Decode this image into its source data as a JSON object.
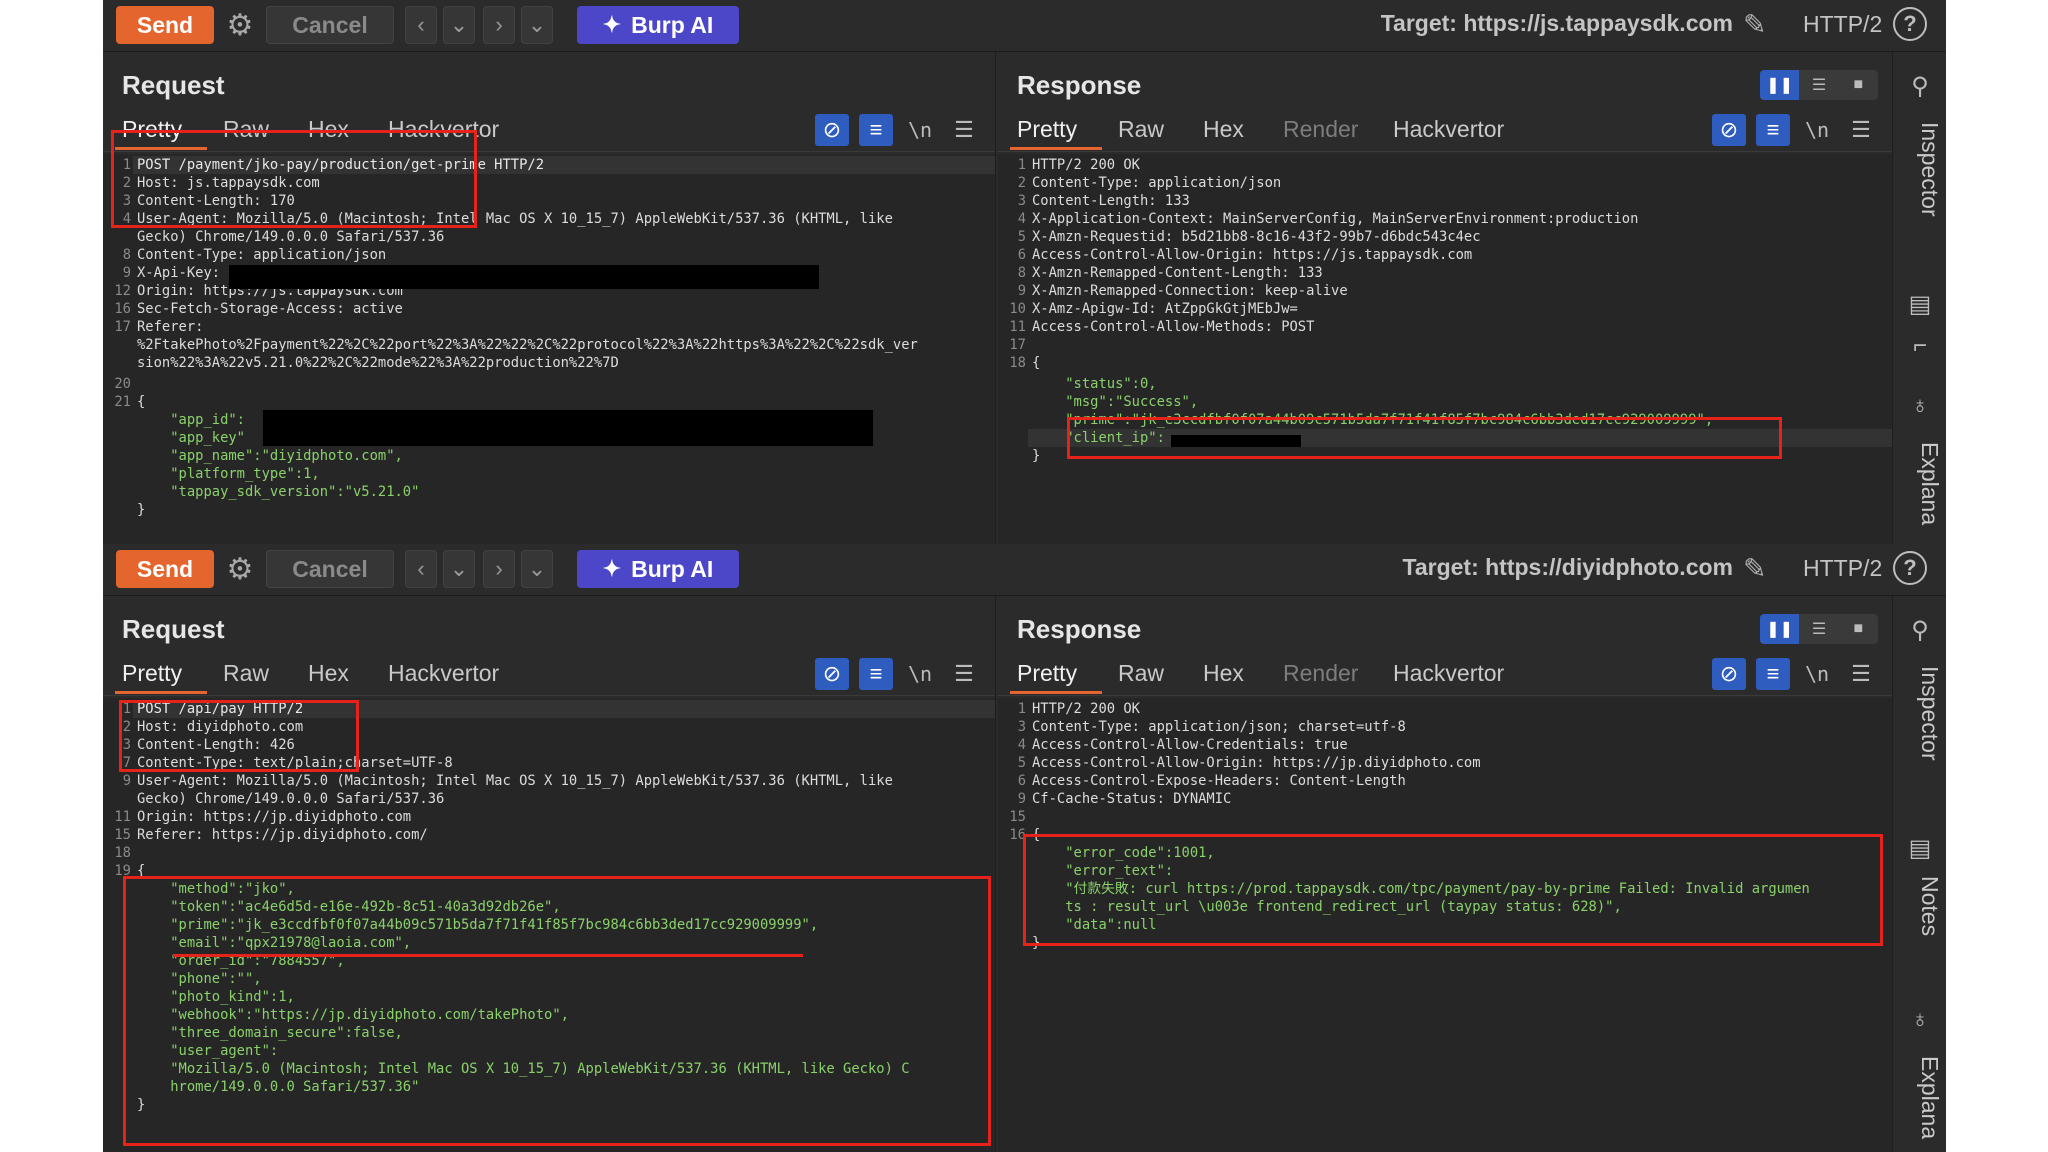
{
  "toolbar": {
    "send": "Send",
    "cancel": "Cancel",
    "burp_ai": "Burp AI",
    "http_version": "HTTP/2",
    "help": "?"
  },
  "panes": [
    {
      "target": "Target: https://js.tappaysdk.com",
      "request": {
        "title": "Request",
        "tabs": [
          "Pretty",
          "Raw",
          "Hex",
          "Hackvertor"
        ],
        "lines": [
          {
            "n": "1",
            "t": "POST /payment/jko-pay/production/get-prime HTTP/2"
          },
          {
            "n": "2",
            "t": "Host: js.tappaysdk.com"
          },
          {
            "n": "3",
            "t": "Content-Length: 170"
          },
          {
            "n": "4",
            "t": "User-Agent: Mozilla/5.0 (Macintosh; Intel Mac OS X 10_15_7) AppleWebKit/537.36 (KHTML, like"
          },
          {
            "n": "",
            "t": "Gecko) Chrome/149.0.0.0 Safari/537.36"
          },
          {
            "n": "8",
            "t": "Content-Type: application/json"
          },
          {
            "n": "9",
            "t": "X-Api-Key:"
          },
          {
            "n": "12",
            "t": "Origin: https://js.tappaysdk.com"
          },
          {
            "n": "16",
            "t": "Sec-Fetch-Storage-Access: active"
          },
          {
            "n": "17",
            "t": "Referer:"
          },
          {
            "n": "",
            "t": "%2FtakePhoto%2Fpayment%22%2C%22port%22%3A%22%22%2C%22protocol%22%3A%22https%3A%22%2C%22sdk_ver"
          },
          {
            "n": "",
            "t": "sion%22%3A%22v5.21.0%22%2C%22mode%22%3A%22production%22%7D"
          },
          {
            "n": "20",
            "t": ""
          },
          {
            "n": "21",
            "t": "{"
          },
          {
            "n": "",
            "t": "    \"app_id\":"
          },
          {
            "n": "",
            "t": "    \"app_key\""
          },
          {
            "n": "",
            "t": "    \"app_name\":\"diyidphoto.com\","
          },
          {
            "n": "",
            "t": "    \"platform_type\":1,"
          },
          {
            "n": "",
            "t": "    \"tappay_sdk_version\":\"v5.21.0\""
          },
          {
            "n": "",
            "t": "}"
          }
        ]
      },
      "response": {
        "title": "Response",
        "tabs": [
          "Pretty",
          "Raw",
          "Hex",
          "Render",
          "Hackvertor"
        ],
        "lines": [
          {
            "n": "1",
            "t": "HTTP/2 200 OK"
          },
          {
            "n": "2",
            "t": "Content-Type: application/json"
          },
          {
            "n": "3",
            "t": "Content-Length: 133"
          },
          {
            "n": "4",
            "t": "X-Application-Context: MainServerConfig, MainServerEnvironment:production"
          },
          {
            "n": "5",
            "t": "X-Amzn-Requestid: b5d21bb8-8c16-43f2-99b7-d6bdc543c4ec"
          },
          {
            "n": "6",
            "t": "Access-Control-Allow-Origin: https://js.tappaysdk.com"
          },
          {
            "n": "8",
            "t": "X-Amzn-Remapped-Content-Length: 133"
          },
          {
            "n": "9",
            "t": "X-Amzn-Remapped-Connection: keep-alive"
          },
          {
            "n": "10",
            "t": "X-Amz-Apigw-Id: AtZppGkGtjMEbJw="
          },
          {
            "n": "11",
            "t": "Access-Control-Allow-Methods: POST"
          },
          {
            "n": "17",
            "t": ""
          },
          {
            "n": "18",
            "t": "{"
          },
          {
            "n": "",
            "t": "    \"status\":0,"
          },
          {
            "n": "",
            "t": "    \"msg\":\"Success\","
          },
          {
            "n": "",
            "t": "    \"prime\":\"jk_e3ccdfbf0f07a44b09c571b5da7f71f41f85f7bc984c6bb3ded17cc929009999\","
          },
          {
            "n": "",
            "t": "    \"client_ip\":"
          },
          {
            "n": "",
            "t": "}"
          }
        ]
      }
    },
    {
      "target": "Target: https://diyidphoto.com",
      "request": {
        "title": "Request",
        "tabs": [
          "Pretty",
          "Raw",
          "Hex",
          "Hackvertor"
        ],
        "lines": [
          {
            "n": "1",
            "t": "POST /api/pay HTTP/2"
          },
          {
            "n": "2",
            "t": "Host: diyidphoto.com"
          },
          {
            "n": "3",
            "t": "Content-Length: 426"
          },
          {
            "n": "7",
            "t": "Content-Type: text/plain;charset=UTF-8"
          },
          {
            "n": "9",
            "t": "User-Agent: Mozilla/5.0 (Macintosh; Intel Mac OS X 10_15_7) AppleWebKit/537.36 (KHTML, like"
          },
          {
            "n": "",
            "t": "Gecko) Chrome/149.0.0.0 Safari/537.36"
          },
          {
            "n": "11",
            "t": "Origin: https://jp.diyidphoto.com"
          },
          {
            "n": "15",
            "t": "Referer: https://jp.diyidphoto.com/"
          },
          {
            "n": "18",
            "t": ""
          },
          {
            "n": "19",
            "t": "{"
          },
          {
            "n": "",
            "t": "    \"method\":\"jko\","
          },
          {
            "n": "",
            "t": "    \"token\":\"ac4e6d5d-e16e-492b-8c51-40a3d92db26e\","
          },
          {
            "n": "",
            "t": "    \"prime\":\"jk_e3ccdfbf0f07a44b09c571b5da7f71f41f85f7bc984c6bb3ded17cc929009999\","
          },
          {
            "n": "",
            "t": "    \"email\":\"qpx21978@laoia.com\","
          },
          {
            "n": "",
            "t": "    \"order_id\":\"7884557\","
          },
          {
            "n": "",
            "t": "    \"phone\":\"\","
          },
          {
            "n": "",
            "t": "    \"photo_kind\":1,"
          },
          {
            "n": "",
            "t": "    \"webhook\":\"https://jp.diyidphoto.com/takePhoto\","
          },
          {
            "n": "",
            "t": "    \"three_domain_secure\":false,"
          },
          {
            "n": "",
            "t": "    \"user_agent\":"
          },
          {
            "n": "",
            "t": "    \"Mozilla/5.0 (Macintosh; Intel Mac OS X 10_15_7) AppleWebKit/537.36 (KHTML, like Gecko) C"
          },
          {
            "n": "",
            "t": "    hrome/149.0.0.0 Safari/537.36\""
          },
          {
            "n": "",
            "t": "}"
          }
        ]
      },
      "response": {
        "title": "Response",
        "tabs": [
          "Pretty",
          "Raw",
          "Hex",
          "Render",
          "Hackvertor"
        ],
        "lines": [
          {
            "n": "1",
            "t": "HTTP/2 200 OK"
          },
          {
            "n": "3",
            "t": "Content-Type: application/json; charset=utf-8"
          },
          {
            "n": "4",
            "t": "Access-Control-Allow-Credentials: true"
          },
          {
            "n": "5",
            "t": "Access-Control-Allow-Origin: https://jp.diyidphoto.com"
          },
          {
            "n": "6",
            "t": "Access-Control-Expose-Headers: Content-Length"
          },
          {
            "n": "9",
            "t": "Cf-Cache-Status: DYNAMIC"
          },
          {
            "n": "15",
            "t": ""
          },
          {
            "n": "16",
            "t": "{"
          },
          {
            "n": "",
            "t": "    \"error_code\":1001,"
          },
          {
            "n": "",
            "t": "    \"error_text\":"
          },
          {
            "n": "",
            "t": "    \"付款失敗: curl https://prod.tappaysdk.com/tpc/payment/pay-by-prime Failed: Invalid argumen"
          },
          {
            "n": "",
            "t": "    ts : result_url \\u003e frontend_redirect_url (taypay status: 628)\","
          },
          {
            "n": "",
            "t": "    \"data\":null"
          },
          {
            "n": "",
            "t": "}"
          }
        ]
      }
    }
  ],
  "sidebar": {
    "inspector": "Inspector",
    "notes": "Notes",
    "explain_truncated": "Explana"
  }
}
